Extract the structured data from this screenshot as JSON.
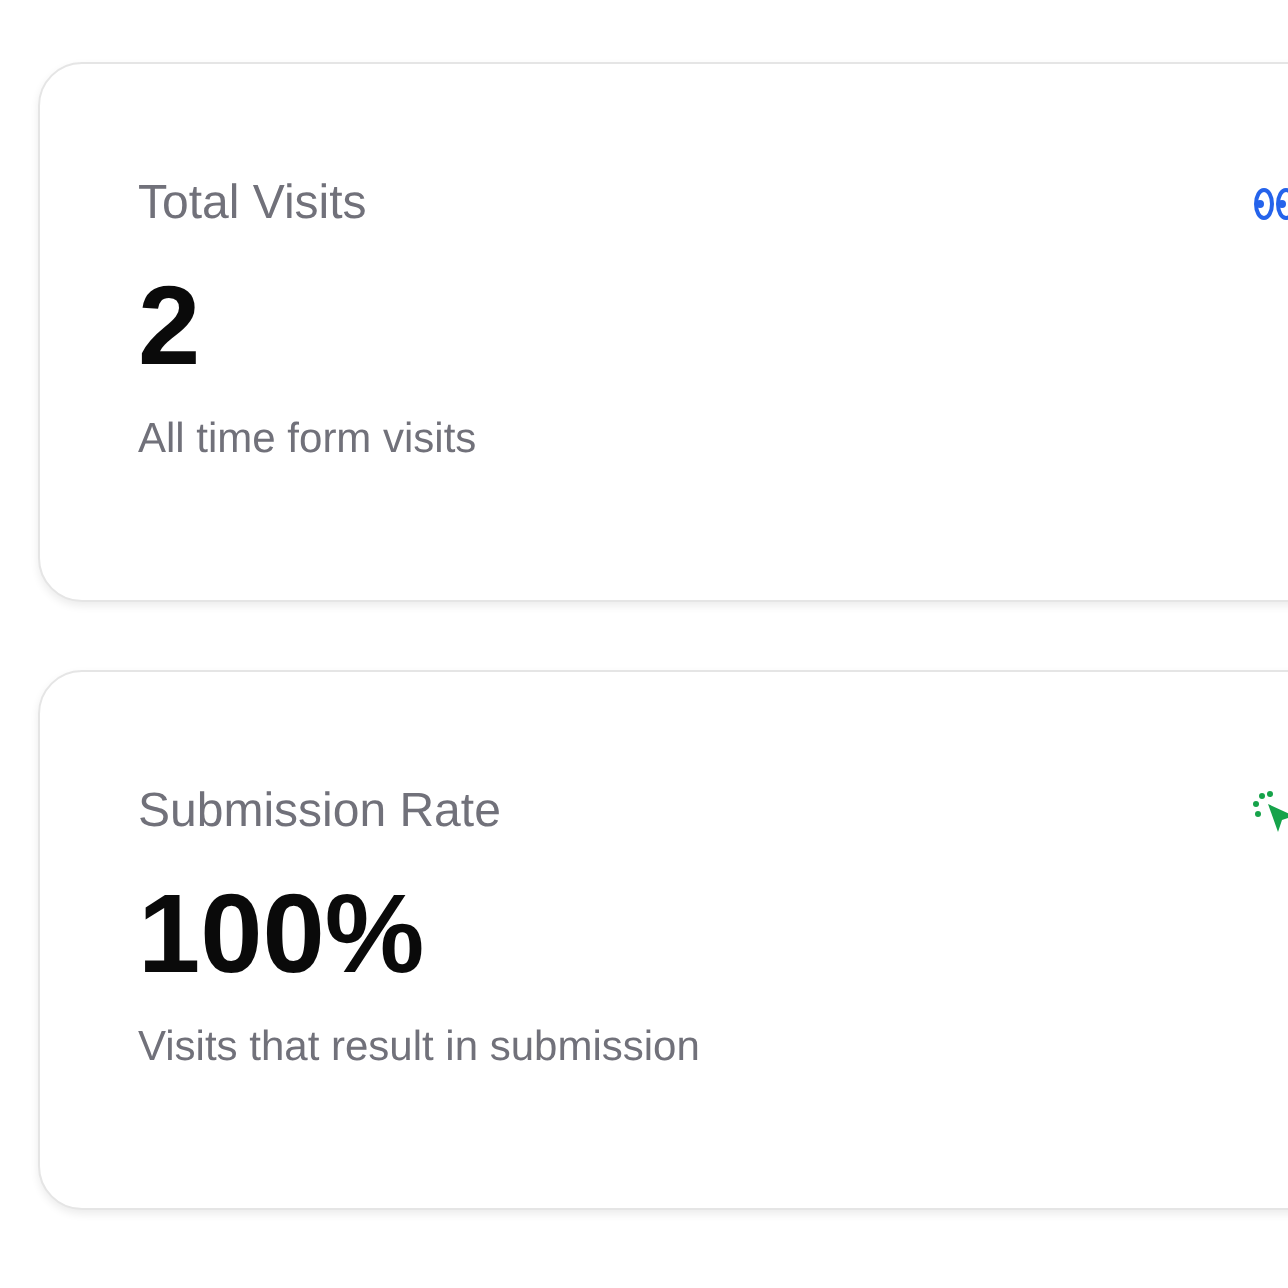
{
  "cards": [
    {
      "title": "Total Visits",
      "value": "2",
      "caption": "All time form visits",
      "kind": "eye"
    },
    {
      "title": "Submission Rate",
      "value": "100%",
      "caption": "Visits that result in submission",
      "kind": "click"
    }
  ]
}
